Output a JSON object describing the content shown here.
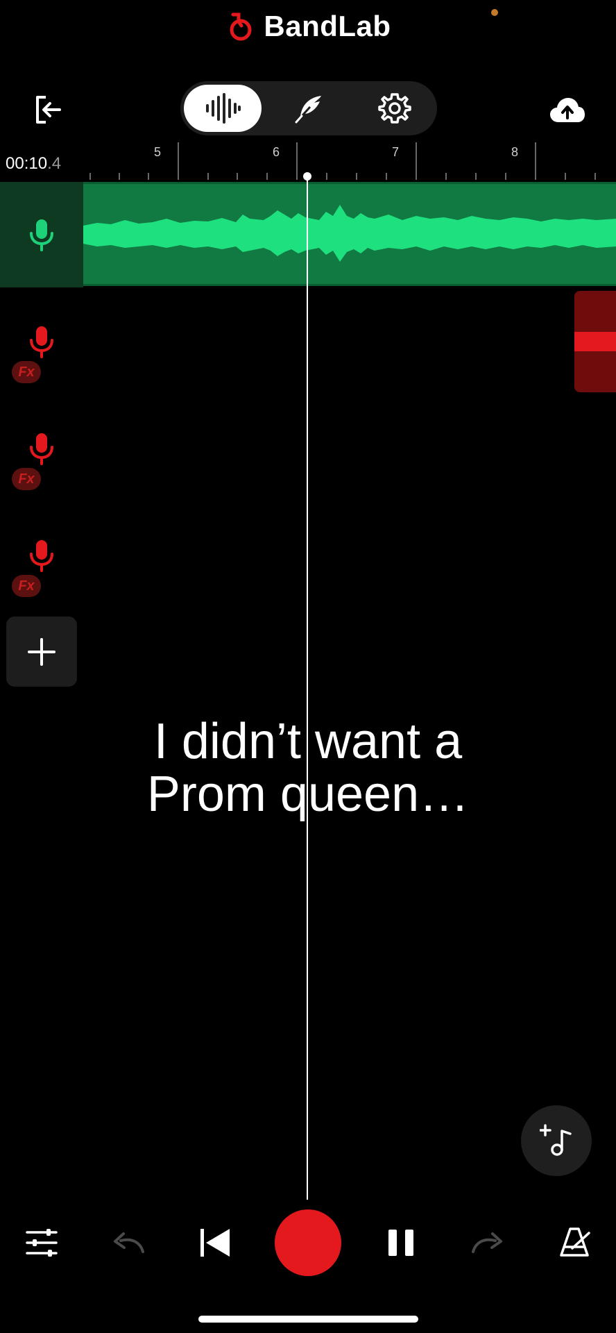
{
  "header": {
    "brand": "BandLab",
    "brand_color": "#e3191d"
  },
  "toolbar": {
    "exit_icon": "exit-icon",
    "modes": [
      {
        "name": "waveform-icon",
        "active": true
      },
      {
        "name": "feather-icon",
        "active": false
      },
      {
        "name": "settings-gear-icon",
        "active": false
      }
    ],
    "upload_icon": "cloud-upload-icon"
  },
  "timeline": {
    "time_main": "00:10",
    "time_frac": ".4",
    "bars": [
      "5",
      "6",
      "7",
      "8"
    ]
  },
  "tracks": [
    {
      "icon": "mic-icon",
      "color": "#1ed27a",
      "selected": true,
      "fx": ""
    },
    {
      "icon": "mic-icon",
      "color": "#e3191d",
      "selected": false,
      "fx": "Fx"
    },
    {
      "icon": "mic-icon",
      "color": "#e3191d",
      "selected": false,
      "fx": "Fx"
    },
    {
      "icon": "mic-icon",
      "color": "#e3191d",
      "selected": false,
      "fx": "Fx"
    }
  ],
  "colors": {
    "clip_bg": "#117a43",
    "waveform": "#1fe07f"
  },
  "caption": {
    "line1": "I didn’t want a",
    "line2": "Prom queen…"
  },
  "bottom_bar": {
    "items": [
      "mixer-sliders-icon",
      "undo-icon",
      "skip-back-icon",
      "record-button",
      "pause-icon",
      "redo-icon",
      "metronome-icon"
    ],
    "record_color": "#e3191d"
  }
}
